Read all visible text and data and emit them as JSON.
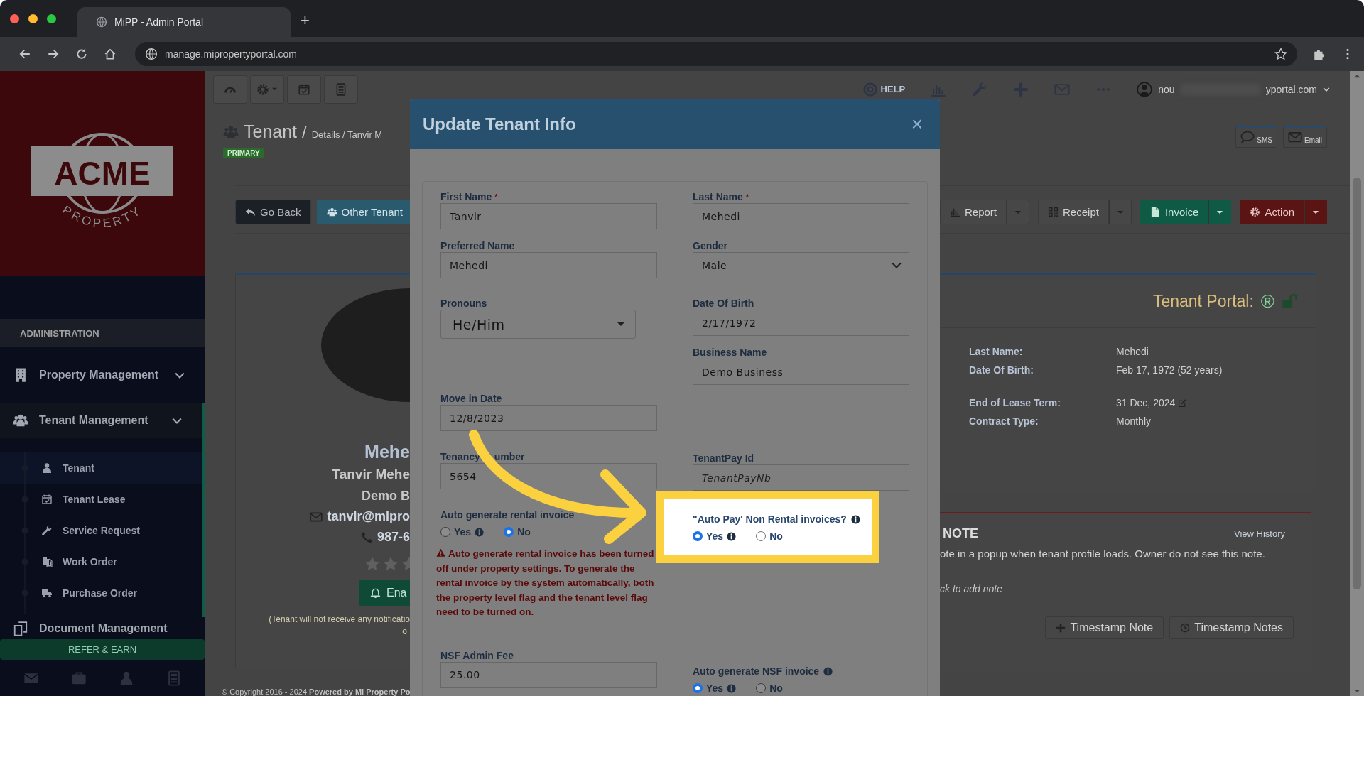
{
  "browser": {
    "tab_title": "MiPP - Admin Portal",
    "new_tab": "+",
    "url": "manage.mipropertyportal.com"
  },
  "sidebar": {
    "logo": {
      "name": "ACME",
      "tagline": "PROPERTY"
    },
    "section": "ADMINISTRATION",
    "items": [
      {
        "label": "Property Management",
        "expandable": true,
        "selected": false
      },
      {
        "label": "Tenant Management",
        "expandable": true,
        "selected": true,
        "children": [
          {
            "label": "Tenant",
            "selected": true
          },
          {
            "label": "Tenant Lease",
            "selected": false
          },
          {
            "label": "Service Request",
            "selected": false
          },
          {
            "label": "Work Order",
            "selected": false
          },
          {
            "label": "Purchase Order",
            "selected": false
          }
        ]
      },
      {
        "label": "Document Management",
        "expandable": false,
        "selected": false
      }
    ],
    "refer": "REFER & EARN"
  },
  "topbar": {
    "help": "HELP",
    "user_start": "nou",
    "user_end": "yportal.com"
  },
  "header": {
    "title": "Tenant",
    "separator": "/",
    "breadcrumb": "Details / Tanvir M",
    "badge": "PRIMARY",
    "contact_buttons": [
      "SMS",
      "Email"
    ]
  },
  "actions": {
    "left": [
      {
        "label": "Go Back",
        "kind": "dark"
      },
      {
        "label": "Other Tenant",
        "kind": "info"
      }
    ],
    "right": [
      {
        "label": "Report",
        "kind": "default"
      },
      {
        "label": "Receipt",
        "kind": "default"
      },
      {
        "label": "Invoice",
        "kind": "success"
      },
      {
        "label": "Action",
        "kind": "danger"
      }
    ]
  },
  "profile": {
    "name": "Mehe",
    "full_name": "Tanvir Mehe",
    "business": "Demo B",
    "email": "tanvir@mipro",
    "phone": "987-6",
    "stars": 0,
    "button": "Ena",
    "notice": "(Tenant will not receive any notificatio",
    "notice_end": "o"
  },
  "portal": {
    "title": "Tenant Portal:",
    "mark": "®",
    "rows": [
      {
        "label": "Last Name:",
        "value": "Mehedi",
        "editable": false
      },
      {
        "label": "Date Of Birth:",
        "value": "Feb 17, 1972 (52 years)",
        "editable": false
      },
      {
        "label": "End of Lease Term:",
        "value": "31 Dec, 2024",
        "editable": true
      },
      {
        "label": "Contract Type:",
        "value": "Monthly",
        "editable": false
      }
    ]
  },
  "note": {
    "title": "NOTE",
    "link": "View History",
    "text": "ote in a popup when tenant profile loads. Owner do not see this note.",
    "placeholder": "ck to add note",
    "buttons": [
      "Timestamp Note",
      "Timestamp Notes"
    ]
  },
  "footer": "© Copyright 2016 - 2024 **Powered by MI Property Po**",
  "modal": {
    "title": "Update Tenant Info",
    "close": "×",
    "left": [
      {
        "kind": "text",
        "label": "First Name",
        "required_mark": "*",
        "value": "Tanvir"
      },
      {
        "kind": "text",
        "label": "Preferred Name",
        "value": "Mehedi"
      },
      {
        "kind": "dropdown",
        "label": "Pronouns",
        "value": "He/Him"
      },
      {
        "kind": "text",
        "label": "Move in Date",
        "value": "12/8/2023"
      },
      {
        "kind": "text",
        "label": "Tenancy",
        "label_tail": "umber",
        "value": "5654"
      },
      {
        "kind": "radio",
        "label": "Auto generate rental invoice",
        "info": false,
        "highlighted": false,
        "options": [
          {
            "label": "Yes",
            "info": true,
            "selected": false
          },
          {
            "label": "No",
            "info": false,
            "selected": true
          }
        ]
      },
      {
        "kind": "warning",
        "text": "Auto generate rental invoice has been turned off under property settings. To generate the rental invoice by the system automatically, both the property level flag and the tenant level flag need to be turned on."
      },
      {
        "kind": "text",
        "label": "NSF Admin Fee",
        "value": "25.00"
      }
    ],
    "right": [
      {
        "kind": "text",
        "label": "Last Name",
        "required_mark": "*",
        "value": "Mehedi"
      },
      {
        "kind": "select",
        "label": "Gender",
        "value": "Male"
      },
      {
        "kind": "text",
        "label": "Date Of Birth",
        "value": "2/17/1972"
      },
      {
        "kind": "text",
        "label": "Business Name",
        "value": "Demo Business"
      },
      {
        "kind": "text",
        "label": "TenantPay Id",
        "placeholder": "TenantPayNb"
      },
      {
        "kind": "radio",
        "label": "\"Auto Pay' Non Rental invoices?",
        "info": true,
        "highlighted": true,
        "options": [
          {
            "label": "Yes",
            "info": true,
            "selected": true
          },
          {
            "label": "No",
            "info": false,
            "selected": false
          }
        ]
      },
      {
        "kind": "radio",
        "label": "Auto generate NSF invoice",
        "info": true,
        "highlighted": false,
        "options": [
          {
            "label": "Yes",
            "info": true,
            "selected": true
          },
          {
            "label": "No",
            "info": false,
            "selected": false
          }
        ]
      }
    ]
  }
}
